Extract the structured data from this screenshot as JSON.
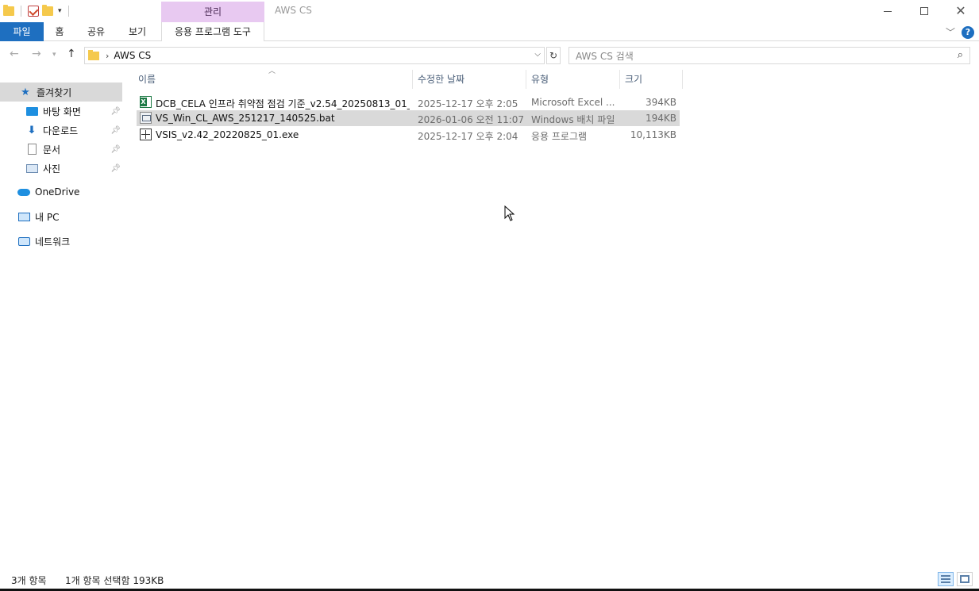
{
  "titlebar": {
    "context_tab_header": "관리",
    "window_title": "AWS CS"
  },
  "ribbon": {
    "tabs": [
      {
        "label": "파일"
      },
      {
        "label": "홈"
      },
      {
        "label": "공유"
      },
      {
        "label": "보기"
      },
      {
        "label": "응용 프로그램 도구"
      }
    ],
    "help_label": "?"
  },
  "address": {
    "crumb": "AWS CS",
    "search_placeholder": "AWS CS 검색"
  },
  "nav": {
    "items": [
      {
        "label": "즐겨찾기",
        "icon": "star-icon"
      },
      {
        "label": "바탕 화면",
        "icon": "desktop-icon",
        "pinned": true
      },
      {
        "label": "다운로드",
        "icon": "download-icon",
        "pinned": true
      },
      {
        "label": "문서",
        "icon": "document-icon",
        "pinned": true
      },
      {
        "label": "사진",
        "icon": "pictures-icon",
        "pinned": true
      },
      {
        "label": "OneDrive",
        "icon": "onedrive-icon"
      },
      {
        "label": "내 PC",
        "icon": "this-pc-icon"
      },
      {
        "label": "네트워크",
        "icon": "network-icon"
      }
    ]
  },
  "columns": {
    "name": "이름",
    "date": "수정한 날짜",
    "type": "유형",
    "size": "크기"
  },
  "files": [
    {
      "name": "DCB_CELA 인프라 취약점 점검 기준_v2.54_20250813_01_...",
      "date": "2025-12-17 오후 2:05",
      "type": "Microsoft Excel ...",
      "size": "394KB",
      "icon": "excel-file-icon"
    },
    {
      "name": "VS_Win_CL_AWS_251217_140525.bat",
      "date": "2026-01-06 오전 11:07",
      "type": "Windows 배치 파일",
      "size": "194KB",
      "icon": "batch-file-icon",
      "selected": true
    },
    {
      "name": "VSIS_v2.42_20220825_01.exe",
      "date": "2025-12-17 오후 2:04",
      "type": "응용 프로그램",
      "size": "10,113KB",
      "icon": "exe-file-icon"
    }
  ],
  "status": {
    "item_count": "3개 항목",
    "selection": "1개 항목 선택함 193KB"
  },
  "colors": {
    "file_tab": "#1e6fc0",
    "context_tab": "#e8c9f1",
    "selection": "#d9d9d9"
  }
}
